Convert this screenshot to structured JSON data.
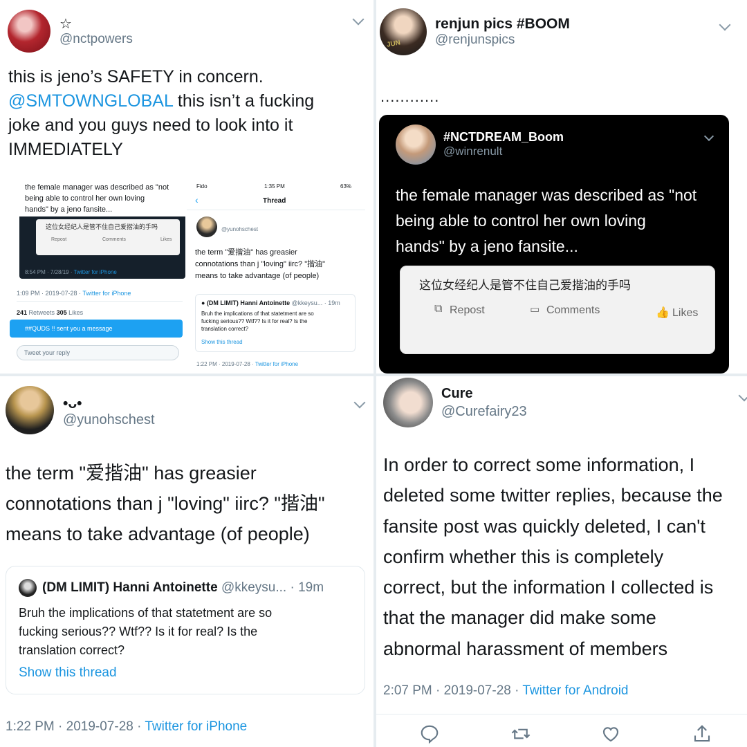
{
  "colors": {
    "link": "#1b95e0",
    "dark_card": "#15202b",
    "black_card": "#000000",
    "muted": "#657786"
  },
  "tweet1": {
    "name": "☆",
    "handle": "@nctpowers",
    "text_line1": "this is jeno’s SAFETY in concern.",
    "mention": "@SMTOWNGLOBAL",
    "text_line2_rest": " this isn’t a fucking",
    "text_line3": "joke and you guys need to look into it",
    "text_line4": "IMMEDIATELY",
    "embed_left": {
      "text1": "the female manager was described as \"not",
      "text2": "being able to control her own loving",
      "text3": "hands\" by a jeno fansite...",
      "weibo_text": "这位女经纪人是管不住自己爱揩油的手吗",
      "repost": "Repost",
      "comments": "Comments",
      "likes": "Likes",
      "inner_meta_time": "8:54 PM · 7/28/19 · ",
      "inner_meta_source": "Twitter for iPhone",
      "meta_time": "1:09 PM · 2019-07-28 · ",
      "meta_source": "Twitter for iPhone",
      "retweets_count": "241",
      "retweets_label": " Retweets ",
      "likes_count": "305",
      "likes_label": " Likes",
      "dm_label": "##QUDS !! sent you a message",
      "reply_placeholder": "Tweet your reply"
    },
    "embed_right": {
      "carrier": "Fido",
      "clock": "1:35 PM",
      "battery": "63%",
      "header": "Thread",
      "handle": "@yunohschest",
      "text1": "the term \"爱揩油\" has greasier",
      "text2": "connotations than j \"loving\" iirc? \"揩油\"",
      "text3": "means to take advantage (of people)",
      "quote_name": "(DM LIMIT) Hanni Antoinette",
      "quote_handle": "@kkeysu... · 19m",
      "quote_text1": "Bruh the implications of that statetment are so",
      "quote_text2": "fucking serious?? Wtf?? Is it for real? Is the",
      "quote_text3": "translation correct?",
      "show_thread": "Show this thread",
      "meta_time": "1:22 PM · 2019-07-28 · ",
      "meta_source": "Twitter for iPhone"
    }
  },
  "tweet2": {
    "name": "renjun pics #BOOM",
    "handle": "@renjunspics",
    "avatar_text": "JUN",
    "text": "............",
    "quoted": {
      "name": "#NCTDREAM_Boom",
      "handle": "@winrenult",
      "text1": "the female manager was described as \"not",
      "text2": "being able to control her own loving",
      "text3": "hands\" by a jeno fansite...",
      "weibo_text": "这位女经纪人是管不住自己爱揩油的手吗",
      "repost": "Repost",
      "comments": "Comments",
      "likes": "Likes"
    }
  },
  "tweet3": {
    "name": "•ᴗ•",
    "handle": "@yunohschest",
    "text1": "the term \"爱揩油\" has greasier",
    "text2": "connotations than j \"loving\" iirc? \"揩油\"",
    "text3": "means to take advantage (of people)",
    "quote": {
      "name": "(DM LIMIT) Hanni Antoinette",
      "handle": "@kkeysu... · 19m",
      "text1": "Bruh the implications of that statetment are so",
      "text2": "fucking serious?? Wtf?? Is it for real? Is the",
      "text3": "translation correct?",
      "show_thread": "Show this thread"
    },
    "meta_time": "1:22 PM · 2019-07-28 · ",
    "meta_source": "Twitter for iPhone"
  },
  "tweet4": {
    "name": "Cure",
    "handle": "@Curefairy23",
    "lines": [
      "In order to  correct some information, I",
      "deleted some twitter replies, because the",
      "fansite post was quickly deleted, I can't",
      "confirm whether this is completely",
      "correct, but the information I collected is",
      "that the manager did make some",
      "abnormal harassment of members"
    ],
    "meta_time": "2:07 PM · 2019-07-28 · ",
    "meta_source": "Twitter for Android"
  }
}
